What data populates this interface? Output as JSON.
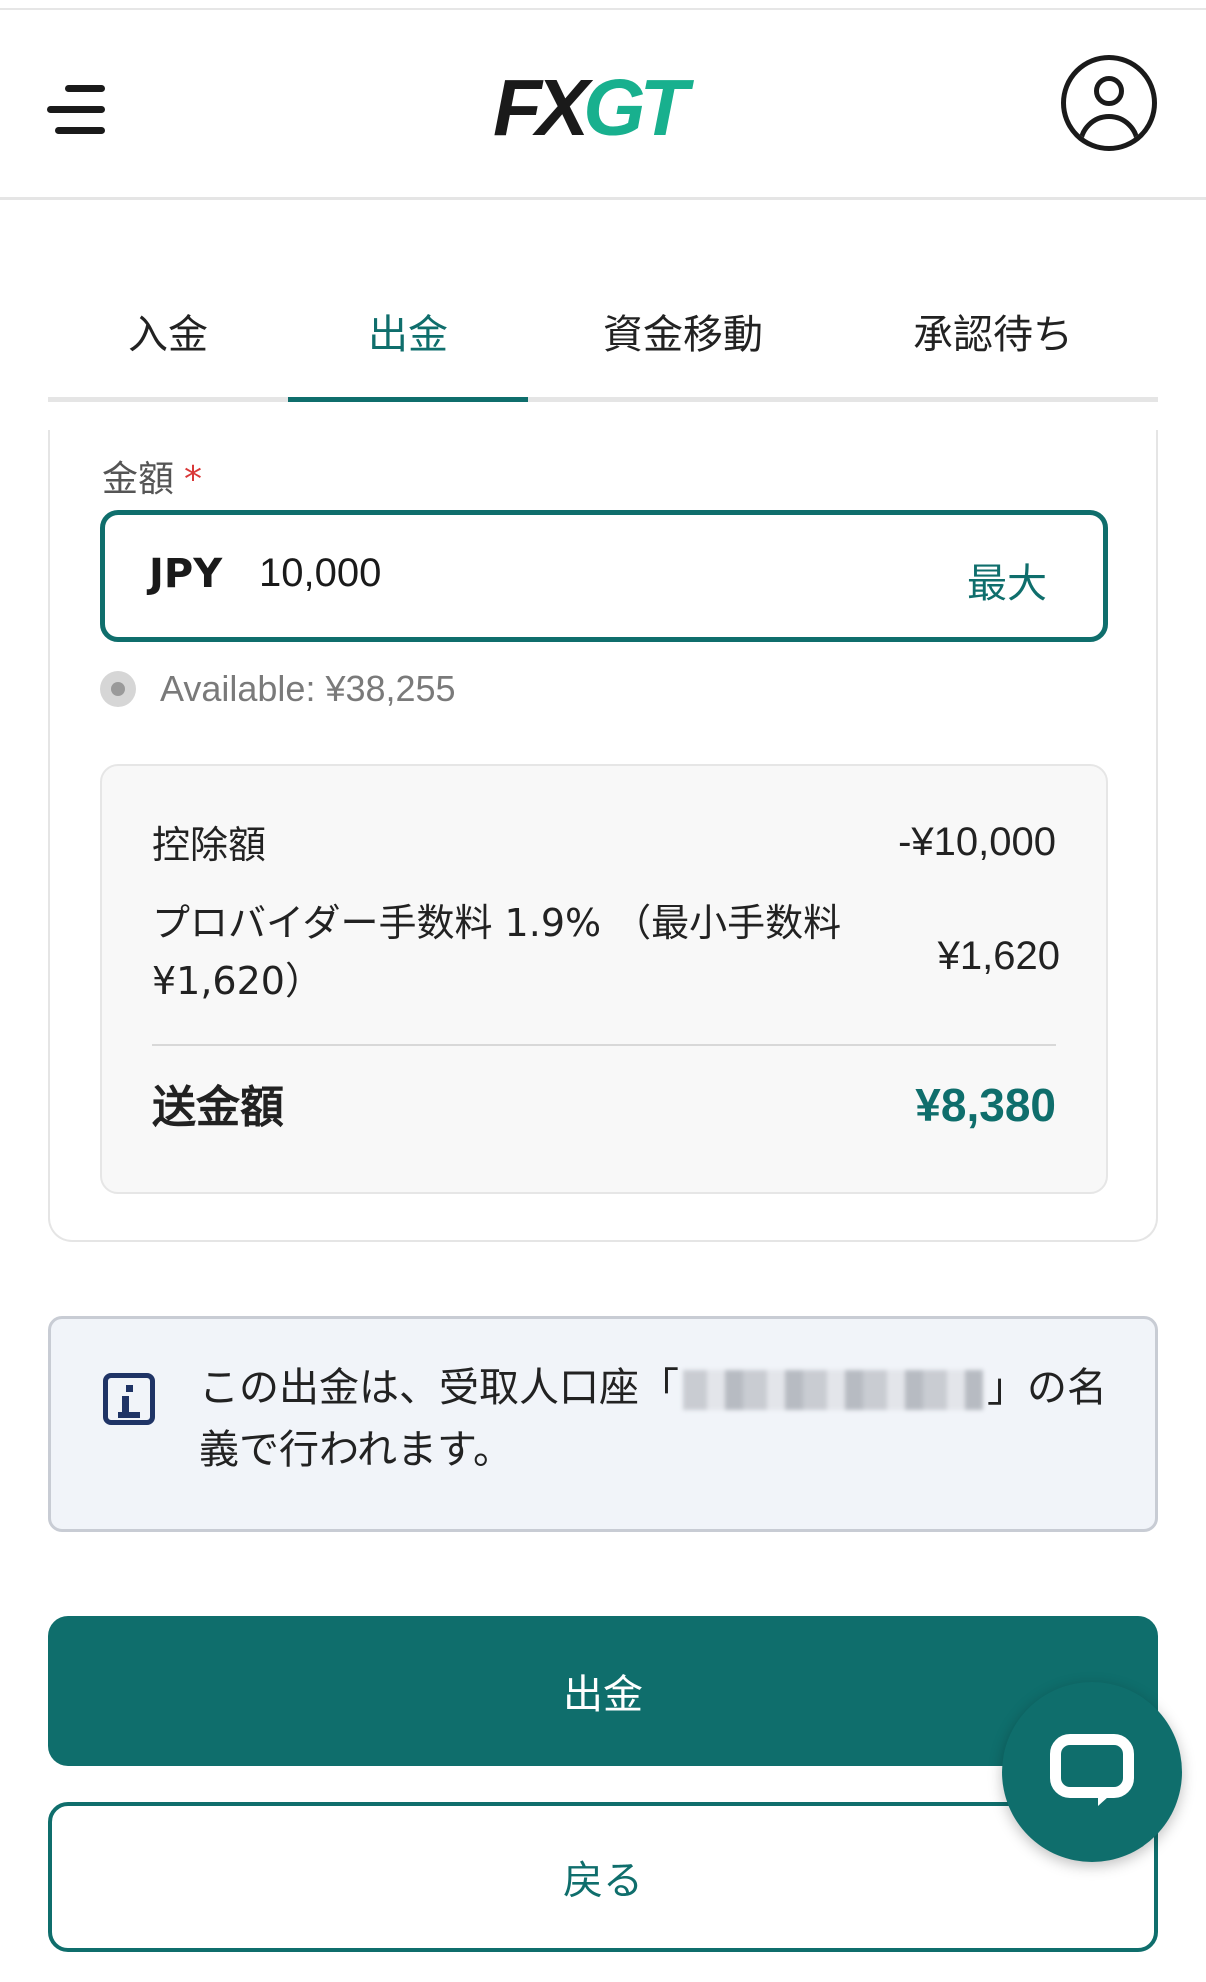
{
  "header": {
    "logo_fx": "FX",
    "logo_gt": "GT",
    "menu_icon": "hamburger-icon",
    "account_icon": "user-icon"
  },
  "tabs": [
    {
      "label": "入金"
    },
    {
      "label": "出金"
    },
    {
      "label": "資金移動"
    },
    {
      "label": "承認待ち"
    }
  ],
  "form": {
    "amount_label": "金額",
    "required_mark": "*",
    "currency": "JPY",
    "amount_value": "10,000",
    "max_label": "最大",
    "available": "Available: ¥38,255"
  },
  "summary": {
    "deduction_label": "控除額",
    "deduction_value": "-¥10,000",
    "fee_label": "プロバイダー手数料 1.9% （最小手数料 ¥1,620）",
    "fee_value": "¥1,620",
    "total_label": "送金額",
    "total_value": "¥8,380"
  },
  "notice": {
    "icon": "info-icon",
    "text_before": "この出金は、受取人口座「",
    "text_after": "」の名義で行われます。"
  },
  "buttons": {
    "withdraw": "出金",
    "back": "戻る"
  },
  "chat": {
    "icon": "chat-icon"
  },
  "colors": {
    "primary": "#0f6e6c",
    "brand_green": "#18b08e",
    "required": "#d93838"
  }
}
